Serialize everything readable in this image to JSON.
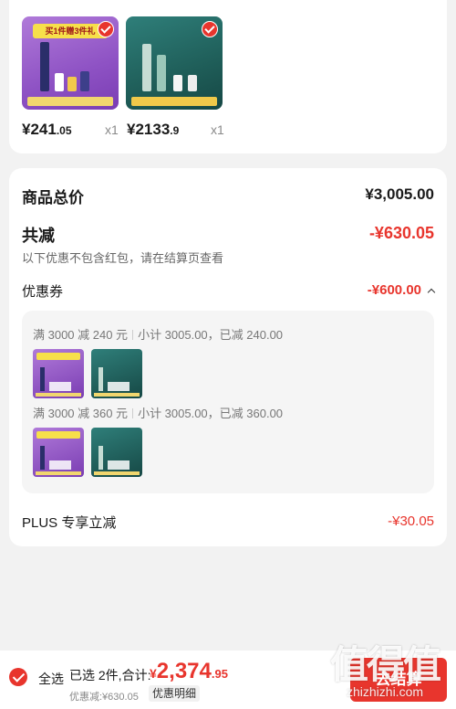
{
  "products": [
    {
      "banner": "买1件赠3件礼",
      "price_main": "¥241",
      "price_decimal": ".05",
      "quantity": "x1"
    },
    {
      "banner": "",
      "price_main": "¥2133",
      "price_decimal": ".9",
      "quantity": "x1"
    }
  ],
  "summary": {
    "total_label": "商品总价",
    "total_value": "¥3,005.00",
    "discount_label": "共减",
    "discount_value": "-¥630.05",
    "discount_note": "以下优惠不包含红包，请在结算页查看",
    "coupon_label": "优惠券",
    "coupon_value": "-¥600.00",
    "coupon_rules": [
      {
        "condition": "满 3000 减 240 元",
        "detail": "小计 3005.00，已减 240.00"
      },
      {
        "condition": "满 3000 减 360 元",
        "detail": "小计 3005.00，已减 360.00"
      }
    ],
    "plus_label": "PLUS 专享立减",
    "plus_value": "-¥30.05"
  },
  "bottom_bar": {
    "select_all": "全选",
    "selected_text": "已选 2件,合计:",
    "currency": "¥",
    "total_main": "2,374",
    "total_decimal": ".95",
    "saved_text": "优惠减:¥630.05",
    "detail_button": "优惠明细",
    "checkout_button": "去结算"
  },
  "watermark": {
    "logo": "值得值",
    "url": "zhizhizhi.com"
  },
  "colors": {
    "accent": "#e8352d",
    "background": "#f2f2f2"
  }
}
